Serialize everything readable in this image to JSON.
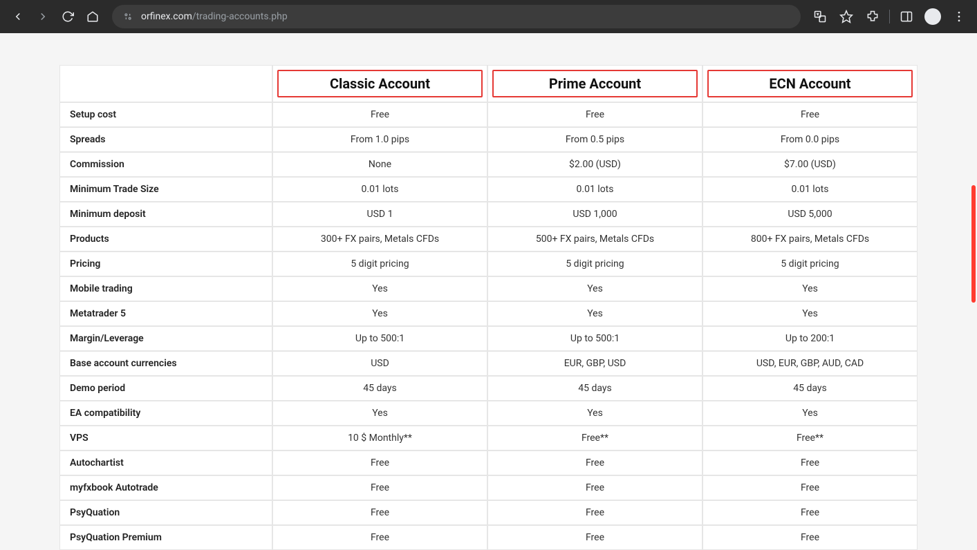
{
  "browser": {
    "url_host": "orfinex.com",
    "url_path": "/trading-accounts.php"
  },
  "table": {
    "headers": {
      "col0": "",
      "col1": "Classic Account",
      "col2": "Prime Account",
      "col3": "ECN Account"
    },
    "rows": [
      {
        "label": "Setup cost",
        "c1": "Free",
        "c2": "Free",
        "c3": "Free"
      },
      {
        "label": "Spreads",
        "c1": "From 1.0 pips",
        "c2": "From 0.5 pips",
        "c3": "From 0.0 pips"
      },
      {
        "label": "Commission",
        "c1": "None",
        "c2": "$2.00 (USD)",
        "c3": "$7.00 (USD)"
      },
      {
        "label": "Minimum Trade Size",
        "c1": "0.01 lots",
        "c2": "0.01 lots",
        "c3": "0.01 lots"
      },
      {
        "label": "Minimum deposit",
        "c1": "USD 1",
        "c2": "USD 1,000",
        "c3": "USD 5,000"
      },
      {
        "label": "Products",
        "c1": "300+ FX pairs, Metals CFDs",
        "c2": "500+ FX pairs, Metals CFDs",
        "c3": "800+ FX pairs, Metals CFDs"
      },
      {
        "label": "Pricing",
        "c1": "5 digit pricing",
        "c2": "5 digit pricing",
        "c3": "5 digit pricing"
      },
      {
        "label": "Mobile trading",
        "c1": "Yes",
        "c2": "Yes",
        "c3": "Yes"
      },
      {
        "label": "Metatrader 5",
        "c1": "Yes",
        "c2": "Yes",
        "c3": "Yes"
      },
      {
        "label": "Margin/Leverage",
        "c1": "Up to 500:1",
        "c2": "Up to 500:1",
        "c3": "Up to 200:1"
      },
      {
        "label": "Base account currencies",
        "c1": "USD",
        "c2": "EUR, GBP, USD",
        "c3": "USD, EUR, GBP, AUD, CAD"
      },
      {
        "label": "Demo period",
        "c1": "45 days",
        "c2": "45 days",
        "c3": "45 days"
      },
      {
        "label": "EA compatibility",
        "c1": "Yes",
        "c2": "Yes",
        "c3": "Yes"
      },
      {
        "label": "VPS",
        "c1": "10 $ Monthly**",
        "c2": "Free**",
        "c3": "Free**"
      },
      {
        "label": "Autochartist",
        "c1": "Free",
        "c2": "Free",
        "c3": "Free"
      },
      {
        "label": "myfxbook Autotrade",
        "c1": "Free",
        "c2": "Free",
        "c3": "Free"
      },
      {
        "label": "PsyQuation",
        "c1": "Free",
        "c2": "Free",
        "c3": "Free"
      },
      {
        "label": "PsyQuation Premium",
        "c1": "Free",
        "c2": "Free",
        "c3": "Free"
      }
    ]
  }
}
